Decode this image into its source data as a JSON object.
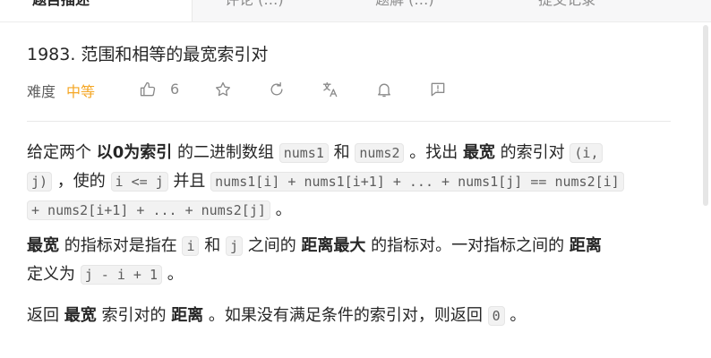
{
  "tabs": [
    {
      "label": "题目描述"
    },
    {
      "label": "评论 (…)"
    },
    {
      "label": "题解 (…)"
    },
    {
      "label": "提交记录"
    }
  ],
  "problem": {
    "title": "1983. 范围和相等的最宽索引对",
    "difficulty_label": "难度",
    "difficulty_value": "中等",
    "likes": "6",
    "icons": [
      "thumbs-up-icon",
      "star-icon",
      "share-icon",
      "translate-icon",
      "bell-icon",
      "feedback-icon"
    ]
  },
  "description": {
    "p1": {
      "t1": "给定两个 ",
      "b1": "以0为索引",
      "t2": " 的二进制数组 ",
      "c1": "nums1",
      "t3": " 和 ",
      "c2": "nums2",
      "t4": " 。找出 ",
      "b2": "最宽",
      "t5": " 的索引对 ",
      "c3": "(i,",
      "c4": "j)",
      "t6": " ，使的 ",
      "c5": "i <= j",
      "t7": " 并且 ",
      "c6": "nums1[i] + nums1[i+1] + ... + nums1[j] == nums2[i]",
      "c7": "+ nums2[i+1] + ... + nums2[j]",
      "t8": " 。"
    },
    "p2": {
      "b1": "最宽",
      "t1": " 的指标对是指在 ",
      "c1": "i",
      "t2": " 和 ",
      "c2": "j",
      "t3": " 之间的 ",
      "b2": "距离最大",
      "t4": " 的指标对。一对指标之间的 ",
      "b3": "距离",
      "t5": "定义为 ",
      "c3": "j - i + 1",
      "t6": " 。"
    },
    "p3": {
      "t1": "返回 ",
      "b1": "最宽",
      "t2": " 索引对的 ",
      "b2": "距离",
      "t3": " 。如果没有满足条件的索引对，则返回 ",
      "c1": "0",
      "t4": " 。"
    }
  }
}
